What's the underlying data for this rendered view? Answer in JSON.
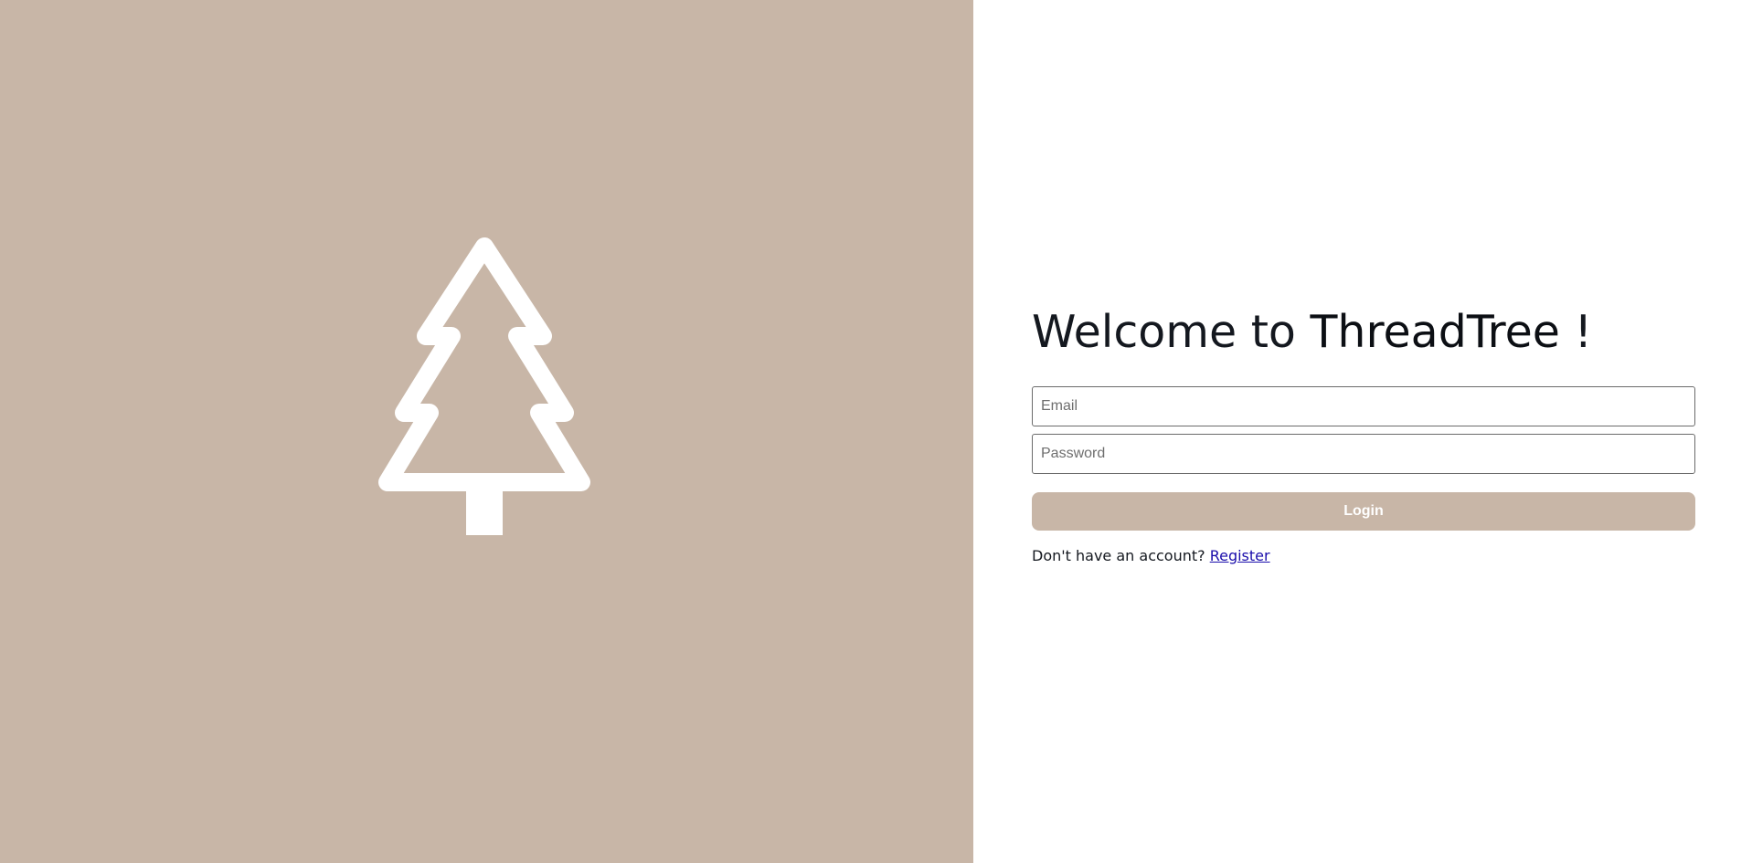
{
  "branding": {
    "logo_icon": "tree-icon",
    "panel_color": "#c8b6a7"
  },
  "login": {
    "title_prefix": "Welcome to ",
    "title_brand": "ThreadTree",
    "title_suffix": " !",
    "email_placeholder": "Email",
    "email_value": "",
    "password_placeholder": "Password",
    "password_value": "",
    "login_label": "Login",
    "register_prompt": "Don't have an account? ",
    "register_link": "Register"
  }
}
